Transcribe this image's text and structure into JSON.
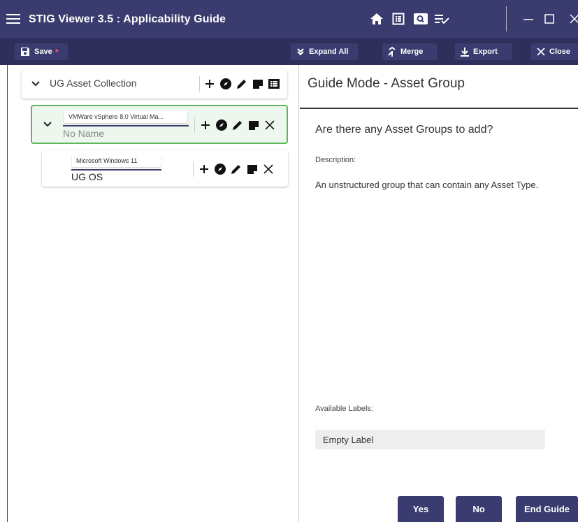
{
  "app": {
    "title": "STIG Viewer 3.5 : Applicability Guide"
  },
  "titlebar_icons": [
    "home-icon",
    "list-icon",
    "search-icon",
    "playlist-check-icon",
    "minimize-icon",
    "maximize-icon",
    "close-window-icon"
  ],
  "toolbar": {
    "save_label": "Save",
    "save_modified_marker": "*",
    "expand_all_label": "Expand All",
    "merge_label": "Merge",
    "export_label": "Export",
    "close_label": "Close"
  },
  "tree": {
    "root": {
      "title": "UG Asset Collection"
    },
    "group": {
      "chip": "VMWare vSphere 8.0 Virtual Ma...",
      "name": "No Name"
    },
    "asset": {
      "chip": "Microsoft Windows 11",
      "name": "UG OS"
    }
  },
  "guide": {
    "title": "Guide Mode - Asset Group",
    "question": "Are there any Asset Groups to add?",
    "description_label": "Description:",
    "description": "An unstructured group that can contain any Asset Type.",
    "available_labels_label": "Available Labels:",
    "labels": [
      "Empty Label"
    ],
    "yes_label": "Yes",
    "no_label": "No",
    "end_label": "End Guide"
  },
  "colors": {
    "titlebar_bg": "#3a3b6e",
    "toolbar_bg": "#2f2f5c",
    "selected_border": "#5cb85c",
    "modified_star": "#ff4b5c"
  }
}
